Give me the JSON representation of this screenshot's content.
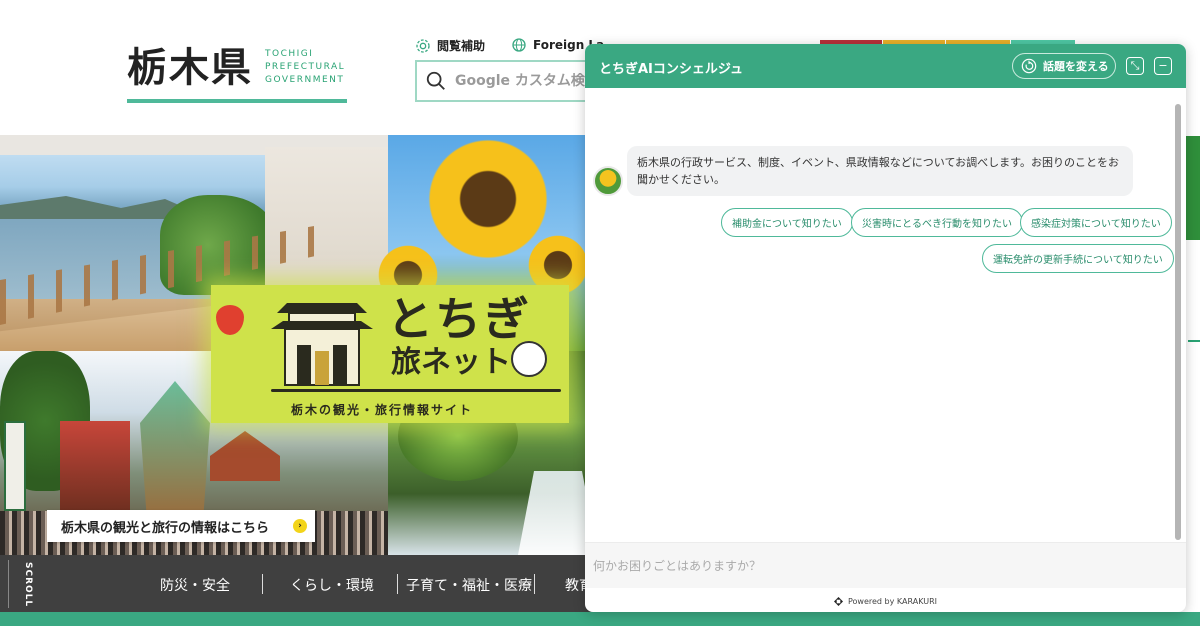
{
  "header": {
    "logo_kanji": "栃木県",
    "logo_en": [
      "TOCHIGI",
      "PREFECTURAL",
      "GOVERNMENT"
    ],
    "accessibility_label": "閲覧補助",
    "foreign_language_label": "Foreign La",
    "search_placeholder": "Google カスタム検索",
    "strip_colors": [
      "#b8323a",
      "#e9b22a",
      "#e9b22a",
      "#4fc9a4"
    ]
  },
  "hero": {
    "banner_title": "とちぎ",
    "banner_subtitle": "旅ネット",
    "banner_tagline": "栃木の観光・旅行情報サイト",
    "link_label": "栃木県の観光と旅行の情報はこちら",
    "link_arrow": "›"
  },
  "gnav": {
    "scroll_label": "SCROLL",
    "items": [
      "防災・安全",
      "くらし・環境",
      "子育て・福祉・医療",
      "教育"
    ]
  },
  "chat": {
    "title": "とちぎAIコンシェルジュ",
    "topic_button": "話題を変える",
    "greeting": "栃木県の行政サービス、制度、イベント、県政情報などについてお調べします。お困りのことをお聞かせください。",
    "suggestions": [
      "補助金について知りたい",
      "災害時にとるべき行動を知りたい",
      "感染症対策について知りたい",
      "運転免許の更新手続について知りたい"
    ],
    "input_placeholder": "何かお困りごとはありますか？",
    "powered_by": "Powered by KARAKURI",
    "accent_color": "#3aa882"
  }
}
